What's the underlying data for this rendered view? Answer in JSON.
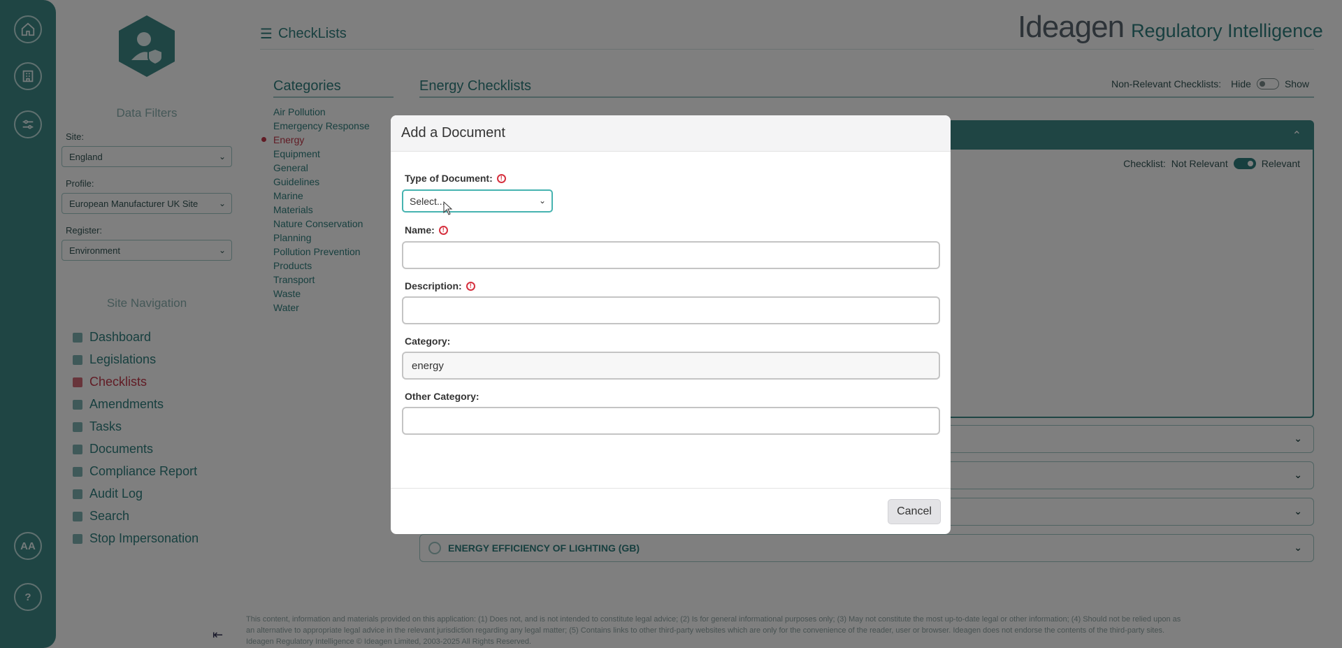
{
  "header": {
    "title": "CheckLists",
    "brand_name": "Ideagen",
    "brand_product": "Regulatory Intelligence"
  },
  "rail": {
    "avatar_initials": "AA"
  },
  "sidebar": {
    "data_filters_heading": "Data Filters",
    "site_label": "Site:",
    "site_value": "England",
    "profile_label": "Profile:",
    "profile_value": "European Manufacturer UK Site",
    "register_label": "Register:",
    "register_value": "Environment",
    "site_nav_heading": "Site Navigation",
    "nav": [
      {
        "label": "Dashboard",
        "icon": "dashboard-icon"
      },
      {
        "label": "Legislations",
        "icon": "gavel-icon"
      },
      {
        "label": "Checklists",
        "icon": "list-icon"
      },
      {
        "label": "Amendments",
        "icon": "edit-icon"
      },
      {
        "label": "Tasks",
        "icon": "tasks-icon"
      },
      {
        "label": "Documents",
        "icon": "document-icon"
      },
      {
        "label": "Compliance Report",
        "icon": "bar-chart-icon"
      },
      {
        "label": "Audit Log",
        "icon": "tag-icon"
      },
      {
        "label": "Search",
        "icon": "search-icon"
      },
      {
        "label": "Stop Impersonation",
        "icon": "stop-icon"
      }
    ]
  },
  "categories": {
    "title": "Categories",
    "items": [
      "Air Pollution",
      "Emergency Response",
      "Energy",
      "Equipment",
      "General",
      "Guidelines",
      "Marine",
      "Materials",
      "Nature Conservation",
      "Planning",
      "Pollution Prevention",
      "Products",
      "Transport",
      "Waste",
      "Water"
    ],
    "active": "Energy"
  },
  "checklists": {
    "title": "Energy Checklists",
    "non_relevant_label": "Non-Relevant Checklists:",
    "hide_label": "Hide",
    "show_label": "Show",
    "checklist_label": "Checklist:",
    "not_relevant_label": "Not Relevant",
    "relevant_label": "Relevant",
    "last_row_title": "ENERGY EFFICIENCY OF LIGHTING (GB)"
  },
  "footer": {
    "line1": "This content, information and materials provided on this application: (1) Does not, and is not intended to constitute legal advice; (2) Is for general informational purposes only; (3) May not constitute the most up-to-date legal or other information; (4) Should not be relied upon as",
    "line2": "an alternative to appropriate legal advice in the relevant jurisdiction regarding any legal matter; (5) Contains links to other third-party websites which are only for the convenience of the reader, user or browser. Ideagen does not endorse the contents of the third-party sites.",
    "line3": "Ideagen Regulatory Intelligence © Ideagen Limited, 2003-2025 All Rights Reserved."
  },
  "modal": {
    "title": "Add a Document",
    "type_label": "Type of Document:",
    "type_value": "Select...",
    "name_label": "Name:",
    "name_value": "",
    "description_label": "Description:",
    "description_value": "",
    "category_label": "Category:",
    "category_value": "energy",
    "other_category_label": "Other Category:",
    "other_category_value": "",
    "cancel_label": "Cancel"
  },
  "colors": {
    "teal": "#3f8a89",
    "active_red": "#c2394a",
    "required_red": "#d6313f",
    "focus_teal": "#46b3b0"
  }
}
